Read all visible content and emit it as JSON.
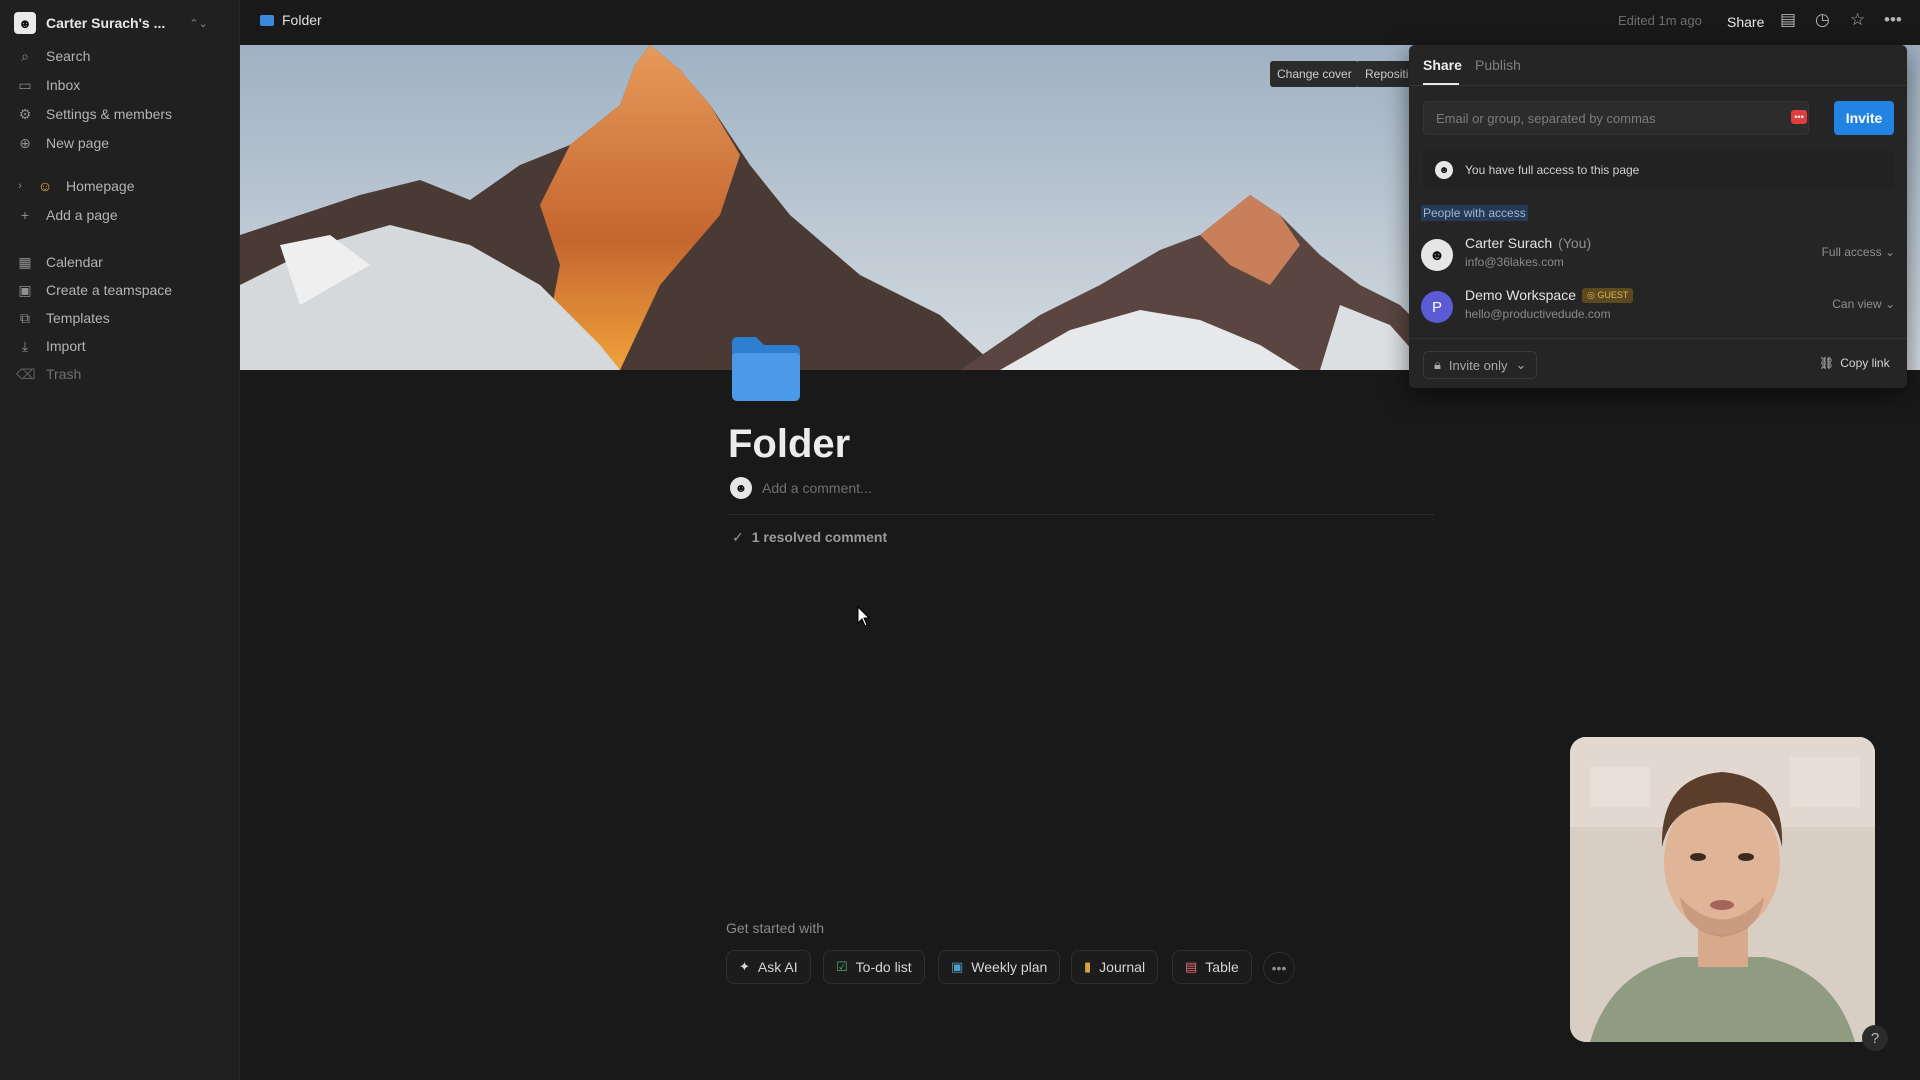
{
  "workspace": {
    "name": "Carter Surach's ...",
    "avatar_glyph": "☻"
  },
  "sidebar": {
    "items": [
      {
        "label": "Search",
        "icon": "search-icon",
        "glyph": "⌕"
      },
      {
        "label": "Inbox",
        "icon": "inbox-icon",
        "glyph": "▭"
      },
      {
        "label": "Settings & members",
        "icon": "gear-icon",
        "glyph": "⚙"
      },
      {
        "label": "New page",
        "icon": "plus-circle-icon",
        "glyph": "⊕"
      },
      {
        "label": "Homepage",
        "icon": "smiley-icon",
        "glyph": "☺"
      },
      {
        "label": "Add a page",
        "icon": "plus-icon",
        "glyph": "+"
      },
      {
        "label": "Calendar",
        "icon": "calendar-icon",
        "glyph": "▦"
      },
      {
        "label": "Create a teamspace",
        "icon": "teamspace-icon",
        "glyph": "▣"
      },
      {
        "label": "Templates",
        "icon": "templates-icon",
        "glyph": "⧉"
      },
      {
        "label": "Import",
        "icon": "import-icon",
        "glyph": "⤓"
      },
      {
        "label": "Trash",
        "icon": "trash-icon",
        "glyph": "🗑"
      }
    ]
  },
  "topbar": {
    "breadcrumb": "Folder",
    "edited": "Edited 1m ago",
    "share": "Share"
  },
  "cover": {
    "change_cover": "Change cover",
    "reposition": "Repositi"
  },
  "page": {
    "title": "Folder",
    "add_comment": "Add a comment...",
    "resolved": "1 resolved comment",
    "get_started": "Get started with",
    "chips": [
      {
        "label": "Ask AI",
        "icon": "sparkle-icon",
        "glyph": "✦",
        "color": "#d6d6d6"
      },
      {
        "label": "To-do list",
        "icon": "checkbox-icon",
        "glyph": "☑",
        "color": "#4dab6f"
      },
      {
        "label": "Weekly plan",
        "icon": "calendar-icon",
        "glyph": "▣",
        "color": "#529cca"
      },
      {
        "label": "Journal",
        "icon": "journal-icon",
        "glyph": "▮",
        "color": "#d9a53a"
      },
      {
        "label": "Table",
        "icon": "table-icon",
        "glyph": "▤",
        "color": "#e06c75"
      }
    ],
    "more": "•••"
  },
  "share_panel": {
    "tab_share": "Share",
    "tab_publish": "Publish",
    "email_placeholder": "Email or group, separated by commas",
    "invite": "Invite",
    "access_note": "You have full access to this page",
    "people_heading": "People with access",
    "people": [
      {
        "name": "Carter Surach",
        "suffix": "(You)",
        "email": "info@36lakes.com",
        "role": "Full access",
        "avatar": "☻",
        "badge": ""
      },
      {
        "name": "Demo Workspace",
        "suffix": "",
        "email": "hello@productivedude.com",
        "role": "Can view",
        "avatar": "P",
        "badge": "GUEST"
      }
    ],
    "invite_only": "Invite only",
    "copy_link": "Copy link"
  },
  "colors": {
    "accent": "#2383e2",
    "folder": "#3b8ad9"
  }
}
